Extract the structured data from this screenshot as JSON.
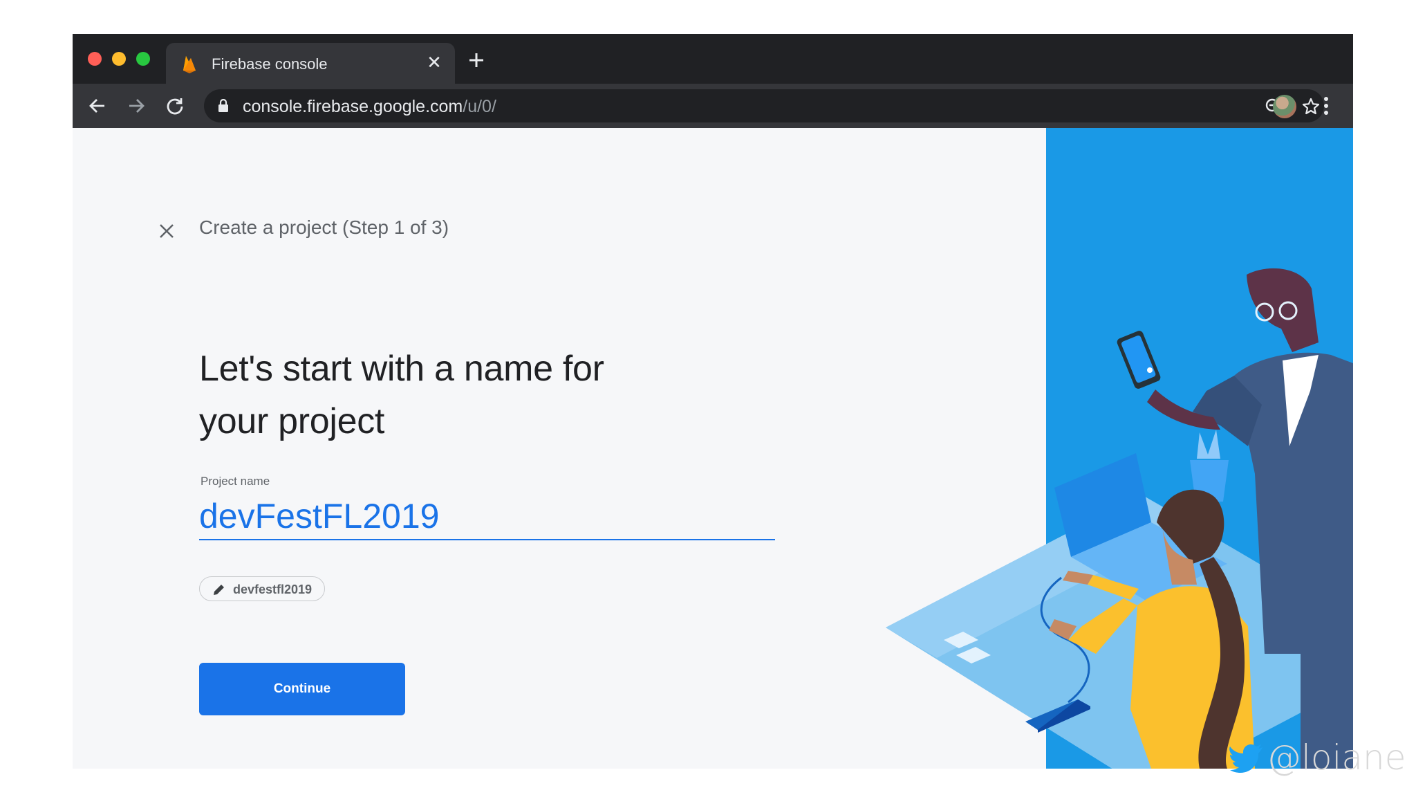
{
  "browser": {
    "tab": {
      "title": "Firebase console",
      "close_glyph": "✕"
    },
    "address": {
      "host": "console.firebase.google.com",
      "path": "/u/0/"
    }
  },
  "dialog": {
    "step_title": "Create a project (Step 1 of 3)",
    "headline_line1": "Let's start with a name for",
    "headline_line2": "your project",
    "project_name_label": "Project name",
    "project_name_value": "devFestFL2019",
    "project_id_chip": "devfestfl2019",
    "continue_label": "Continue"
  },
  "watermark": {
    "handle": "@loiane"
  },
  "colors": {
    "accent": "#1a73e8",
    "illustration_bg": "#1a99e6",
    "chrome_dark": "#202124",
    "chrome_toolbar": "#35363a"
  },
  "icons": [
    "firebase-flame-icon",
    "close-icon",
    "plus-icon",
    "back-arrow-icon",
    "forward-arrow-icon",
    "reload-icon",
    "lock-icon",
    "zoom-out-icon",
    "star-icon",
    "kebab-menu-icon",
    "pencil-icon",
    "twitter-bird-icon"
  ]
}
